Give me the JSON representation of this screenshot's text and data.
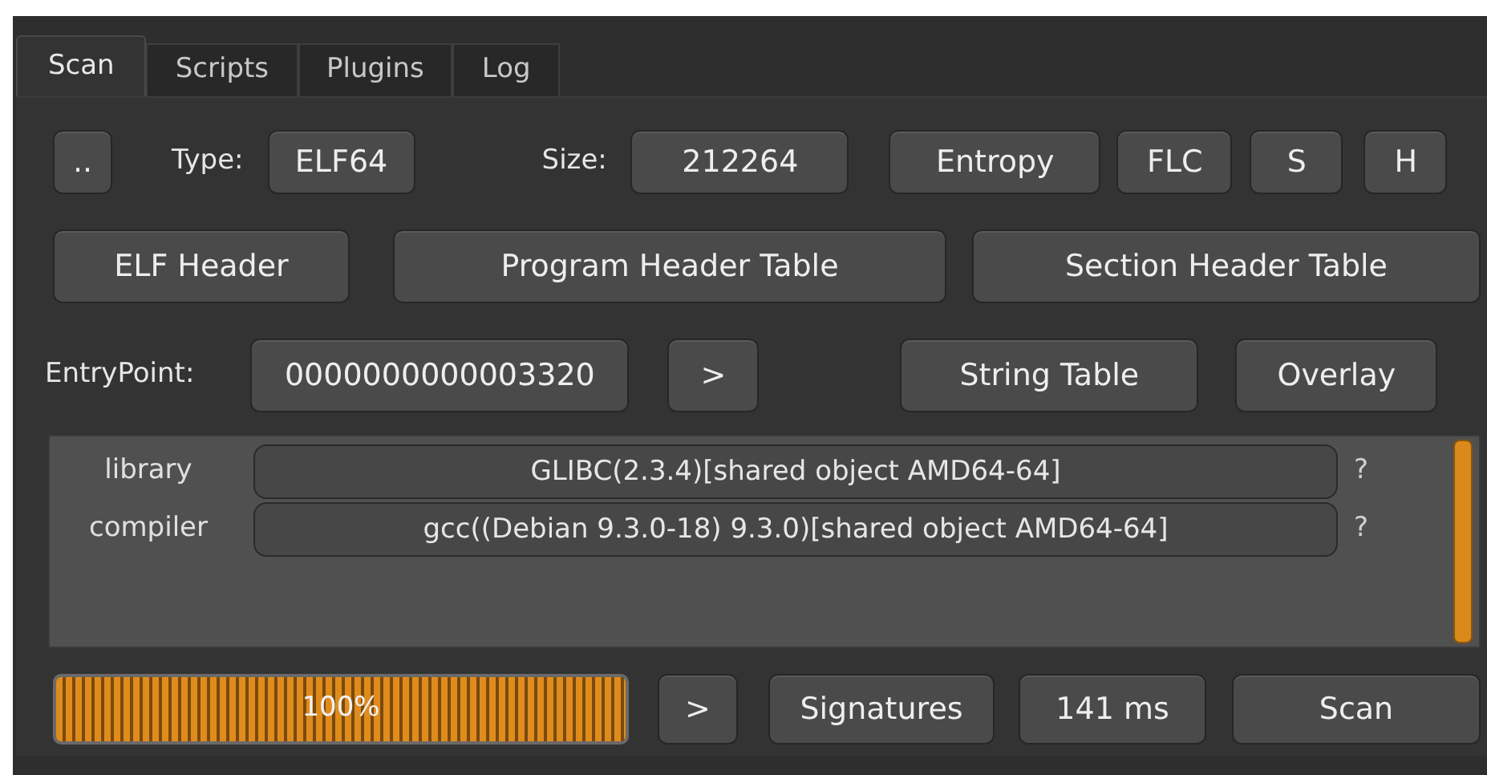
{
  "tabs": [
    {
      "label": "Scan",
      "selected": true
    },
    {
      "label": "Scripts",
      "selected": false
    },
    {
      "label": "Plugins",
      "selected": false
    },
    {
      "label": "Log",
      "selected": false
    }
  ],
  "row1": {
    "browse": "..",
    "type_label": "Type:",
    "type_value": "ELF64",
    "size_label": "Size:",
    "size_value": "212264",
    "buttons": [
      "Entropy",
      "FLC",
      "S",
      "H"
    ]
  },
  "row2": {
    "buttons": [
      "ELF Header",
      "Program Header Table",
      "Section Header Table"
    ]
  },
  "row3": {
    "entry_label": "EntryPoint:",
    "entry_value": "0000000000003320",
    "go": ">",
    "buttons": [
      "String Table",
      "Overlay"
    ]
  },
  "detections": [
    {
      "type": "library",
      "value": "GLIBC(2.3.4)[shared object AMD64-64]",
      "info": "?"
    },
    {
      "type": "compiler",
      "value": "gcc((Debian 9.3.0-18) 9.3.0)[shared object AMD64-64]",
      "info": "?"
    }
  ],
  "bottom": {
    "progress": {
      "level": 1,
      "text": "100%"
    },
    "go": ">",
    "signatures": "Signatures",
    "time": "141 ms",
    "scan": "Scan"
  }
}
